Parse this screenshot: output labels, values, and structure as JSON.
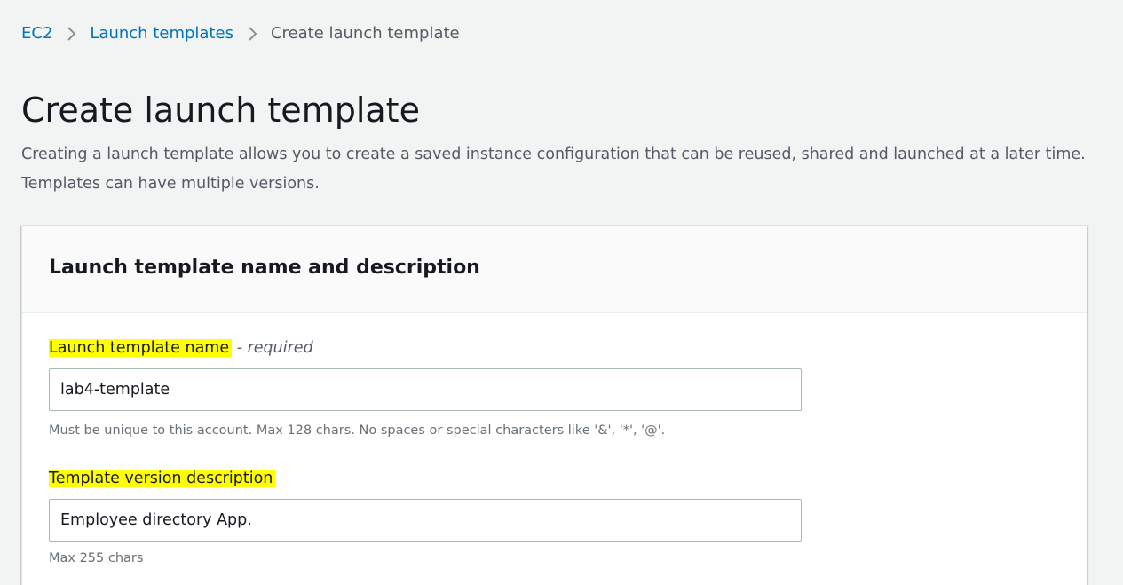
{
  "breadcrumb": {
    "items": [
      "EC2",
      "Launch templates"
    ],
    "current": "Create launch template"
  },
  "header": {
    "title": "Create launch template",
    "description": "Creating a launch template allows you to create a saved instance configuration that can be reused, shared and launched at a later time. Templates can have multiple versions."
  },
  "section": {
    "title": "Launch template name and description",
    "name_field": {
      "label": "Launch template name",
      "label_suffix": " - ",
      "required_text": "required",
      "value": "lab4-template",
      "hint": "Must be unique to this account. Max 128 chars. No spaces or special characters like '&', '*', '@'."
    },
    "description_field": {
      "label": "Template version description",
      "value": "Employee directory App.",
      "hint": "Max 255 chars"
    }
  },
  "colors": {
    "link": "#0073bb",
    "highlight": "#ffff00",
    "background": "#f2f3f3",
    "text": "#16191f",
    "secondary_text": "#545b64"
  },
  "icons": {
    "breadcrumb_separator": "chevron-right-icon"
  }
}
